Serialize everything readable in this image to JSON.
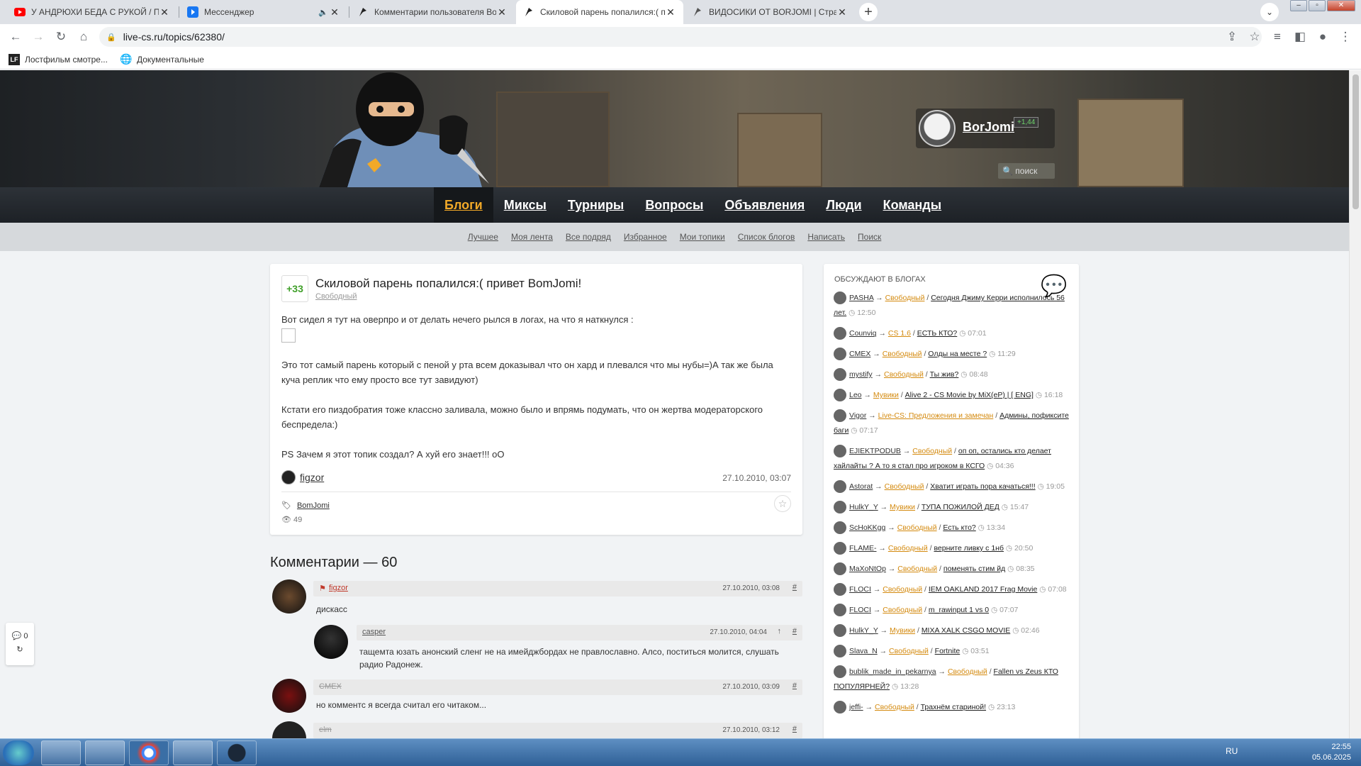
{
  "browser": {
    "tabs": [
      {
        "title": "У АНДРЮХИ БЕДА С РУКОЙ / ПЕ",
        "favicon": "youtube-icon",
        "active": false
      },
      {
        "title": "Мессенджер",
        "favicon": "messenger-icon",
        "active": false,
        "muted": true
      },
      {
        "title": "Комментарии пользователя Borjo",
        "favicon": "live-cs-icon",
        "active": false
      },
      {
        "title": "Скиловой парень попалился:( п",
        "favicon": "live-cs-icon",
        "active": true
      },
      {
        "title": "ВИДОСИКИ ОТ BORJOMI | Стран",
        "favicon": "live-cs-icon",
        "active": false
      }
    ],
    "url": "live-cs.ru/topics/62380/",
    "bookmarks": [
      {
        "label": "Лостфильм смотре...",
        "icon": "LF"
      },
      {
        "label": "Документальные",
        "icon": "globe-icon"
      }
    ]
  },
  "site": {
    "username": "BorJomi",
    "rating": "+1,44",
    "search_placeholder": "поиск",
    "nav": [
      "Блоги",
      "Миксы",
      "Турниры",
      "Вопросы",
      "Объявления",
      "Люди",
      "Команды"
    ],
    "subnav": [
      "Лучшее",
      "Моя лента",
      "Все подряд",
      "Избранное",
      "Мои топики",
      "Список блогов",
      "Написать",
      "Поиск"
    ]
  },
  "topic": {
    "votes": "+33",
    "title": "Скиловой парень попалился:( привет BomJomi!",
    "blog": "Свободный",
    "paragraphs": [
      "Вот сидел я тут на оверпро и от делать нечего рылся в логах, на что я наткнулся :",
      "Это тот самый парень который с пеной у рта всем доказывал что он хард и плевался что мы нубы=)А так же была куча реплик что ему просто все тут завидуют)",
      "Кстати его пиздобратия тоже классно заливала, можно было и впрямь подумать, что он жертва модераторского беспредела:)",
      "PS Зачем я этот топик создал? А хуй его знает!!! oO"
    ],
    "author": "figzor",
    "date": "27.10.2010, 03:07",
    "tag": "BomJomi",
    "views": "49"
  },
  "comments_header": "Комментарии — 60",
  "comments": [
    {
      "author": "figzor",
      "date": "27.10.2010, 03:08",
      "hash": "#",
      "text": "дискасс"
    },
    {
      "author": "casper",
      "date": "27.10.2010, 04:04",
      "hash": "#",
      "up": "↑",
      "text": "тащемта юзать анонский сленг не на имейджбордах не правлославно. Алсо, поститься молится, слушать радио Радонеж."
    },
    {
      "author": "CMEX",
      "date": "27.10.2010, 03:09",
      "hash": "#",
      "text": "но комментс я всегда считал его читаком..."
    },
    {
      "author": "elm",
      "date": "27.10.2010, 03:12",
      "hash": "#",
      "text": ""
    }
  ],
  "sidebar": {
    "title": "Обсуждают в блогах",
    "items": [
      {
        "user": "PASHA",
        "blog": "Свободный",
        "topic": "Сегодня Джиму Керри исполнилось 56 лет.",
        "time": "12:50"
      },
      {
        "user": "Counviq",
        "blog": "CS 1.6",
        "topic": "ЕСТЬ КТО?",
        "time": "07:01"
      },
      {
        "user": "CMEX",
        "blog": "Свободный",
        "topic": "Олды на месте ?",
        "time": "11:29"
      },
      {
        "user": "mystify",
        "blog": "Свободный",
        "topic": "Ты жив?",
        "time": "08:48"
      },
      {
        "user": "Leo",
        "blog": "Мувики",
        "topic": "Alive 2 - CS Movie by MiX(eP) | [ ENG]",
        "time": "16:18"
      },
      {
        "user": "Vigor",
        "blog": "Live-CS: Предложения и замечан",
        "topic": "Админы, пофиксите баги",
        "time": "07:17"
      },
      {
        "user": "EJIEKTPODUB",
        "blog": "Свободный",
        "topic": "оп оп, остались кто делает хайлайты ? А то я стал про игроком в КСГО",
        "time": "04:36"
      },
      {
        "user": "Astorat",
        "blog": "Свободный",
        "topic": "Хватит играть пора качаться!!!",
        "time": "19:05"
      },
      {
        "user": "HulkY_Y",
        "blog": "Мувики",
        "topic": "ТУПА ПОЖИЛОЙ ДЕД",
        "time": "15:47"
      },
      {
        "user": "ScHoKKgg",
        "blog": "Свободный",
        "topic": "Есть кто?",
        "time": "13:34"
      },
      {
        "user": "FLAME-",
        "blog": "Свободный",
        "topic": "верните ливку с 1нб",
        "time": "20:50"
      },
      {
        "user": "MaXoNtOp",
        "blog": "Свободный",
        "topic": "поменять стим йд",
        "time": "08:35"
      },
      {
        "user": "FLOCI",
        "blog": "Свободный",
        "topic": "IEM OAKLAND 2017 Frag Movie",
        "time": "07:08"
      },
      {
        "user": "FLOCI",
        "blog": "Свободный",
        "topic": "m_rawinput 1 vs 0",
        "time": "07:07"
      },
      {
        "user": "HulkY_Y",
        "blog": "Мувики",
        "topic": "MIXA XALK CSGO MOVIE",
        "time": "02:46"
      },
      {
        "user": "Slava_N",
        "blog": "Свободный",
        "topic": "Fortnite",
        "time": "03:51"
      },
      {
        "user": "bublik_made_in_pekarnya",
        "blog": "Свободный",
        "topic": "Fallen vs Zeus КТО ПОПУЛЯРНЕЙ?",
        "time": "13:28"
      },
      {
        "user": "jeffi-",
        "blog": "Свободный",
        "topic": "Трахнём стариной!",
        "time": "23:13"
      }
    ]
  },
  "widget": {
    "count": "0"
  },
  "taskbar": {
    "lang": "RU",
    "time": "22:55",
    "date": "05.06.2025"
  }
}
